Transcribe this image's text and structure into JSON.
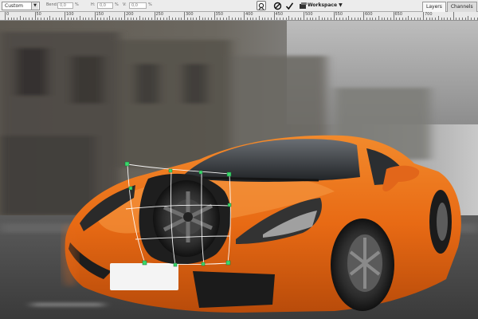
{
  "options_bar": {
    "preset_value": "Custom",
    "bend_label": "Bend:",
    "bend_value": "0,0",
    "h_label": "H:",
    "h_value": "0,0",
    "v_label": "V:",
    "v_value": "0,0",
    "percent": "%",
    "workspace_label": "Workspace"
  },
  "panel_tabs": [
    "Layers",
    "Channels",
    "Pa"
  ],
  "ruler": {
    "labels": [
      "0",
      "50",
      "100",
      "150",
      "200",
      "250",
      "300",
      "350",
      "400",
      "450",
      "500",
      "550",
      "600",
      "650",
      "700"
    ]
  },
  "colors": {
    "car_body": "#e86a14",
    "warp_grid": "#ffffff",
    "warp_handle": "#39d96a"
  },
  "icons": [
    "warp-mode-icon",
    "cancel-icon",
    "commit-icon",
    "palette-icon",
    "dropdown-arrow-icon"
  ]
}
